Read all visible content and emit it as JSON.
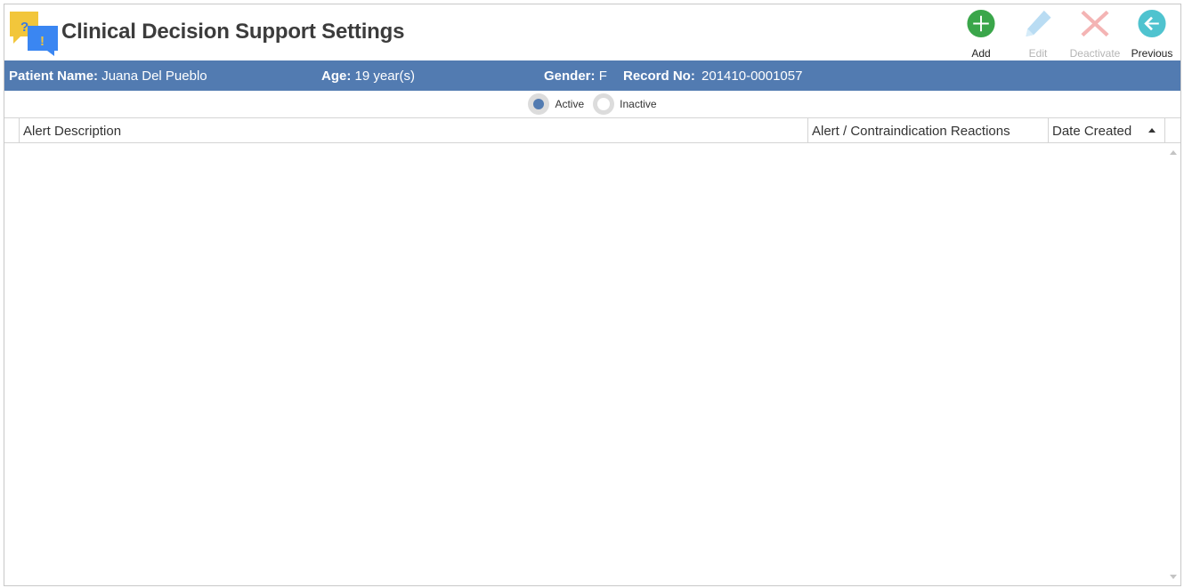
{
  "header": {
    "title": "Clinical Decision Support Settings",
    "logo_icon": "alert-chat-bubbles-icon"
  },
  "toolbar": {
    "add_label": "Add",
    "edit_label": "Edit",
    "deactivate_label": "Deactivate",
    "previous_label": "Previous"
  },
  "patient": {
    "name_label": "Patient Name:",
    "name_value": "Juana Del Pueblo",
    "age_label": "Age:",
    "age_value": "19 year(s)",
    "gender_label": "Gender:",
    "gender_value": "F",
    "record_label": "Record No:",
    "record_value": "201410-0001057"
  },
  "filter": {
    "active_label": "Active",
    "inactive_label": "Inactive",
    "selected": "Active"
  },
  "grid": {
    "columns": [
      "Alert Description",
      "Alert / Contraindication Reactions",
      "Date Created"
    ],
    "sort_column": "Date Created",
    "sort_direction": "ascending",
    "rows": []
  },
  "colors": {
    "accent": "#527bb1",
    "add": "#3aa64a",
    "previous": "#4fc3cf"
  }
}
